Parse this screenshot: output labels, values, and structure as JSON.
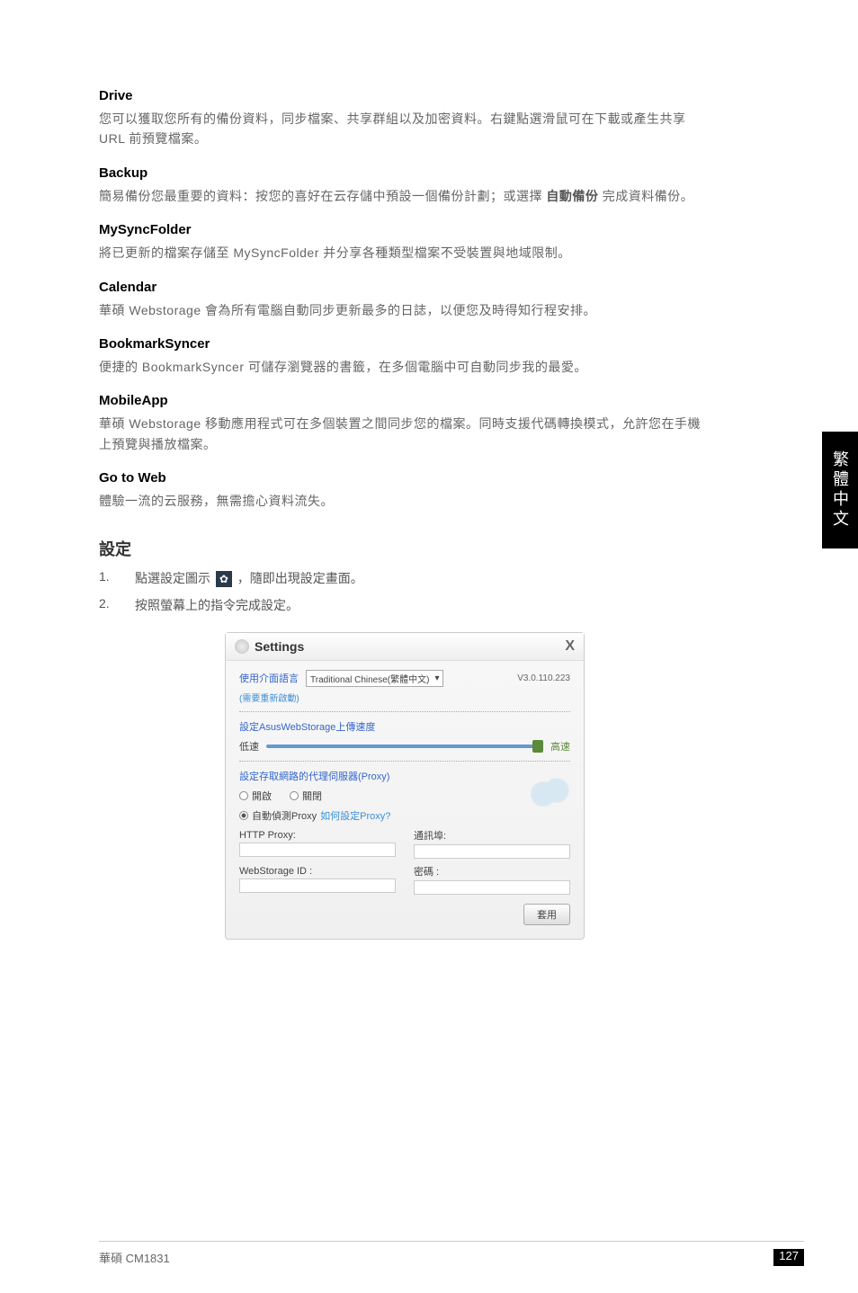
{
  "sections": {
    "drive": {
      "title": "Drive",
      "text": "您可以獲取您所有的備份資料，同步檔案、共享群組以及加密資料。右鍵點選滑鼠可在下載或產生共享 URL 前預覽檔案。"
    },
    "backup": {
      "title": "Backup",
      "text_part1": "簡易備份您最重要的資料：按您的喜好在云存儲中預設一個備份計劃；或選擇 ",
      "text_bold": "自動備份",
      "text_part2": " 完成資料備份。"
    },
    "mysyncfolder": {
      "title": "MySyncFolder",
      "text": "將已更新的檔案存儲至 MySyncFolder 并分享各種類型檔案不受裝置與地域限制。"
    },
    "calendar": {
      "title": "Calendar",
      "text": "華碩 Webstorage 會為所有電腦自動同步更新最多的日誌，以便您及時得知行程安排。"
    },
    "bookmarksyncer": {
      "title": "BookmarkSyncer",
      "text": "便捷的 BookmarkSyncer 可儲存瀏覽器的書籤，在多個電腦中可自動同步我的最愛。"
    },
    "mobileapp": {
      "title": "MobileApp",
      "text": "華碩 Webstorage 移動應用程式可在多個裝置之間同步您的檔案。同時支援代碼轉換模式，允許您在手機上預覽與播放檔案。"
    },
    "gotoweb": {
      "title": "Go to Web",
      "text": "體驗一流的云服務，無需擔心資料流失。"
    }
  },
  "settings_section": {
    "title": "設定",
    "step1_part1": "點選設定圖示 ",
    "step1_part2": " ，隨即出現設定畫面。",
    "step2": "按照螢幕上的指令完成設定。"
  },
  "dialog": {
    "title": "Settings",
    "close": "X",
    "lang_label": "使用介面語言",
    "lang_value": "Traditional Chinese(繁體中文)",
    "version": "V3.0.110.223",
    "restart_note": "(需要重新啟動)",
    "upload_speed_label": "設定AsusWebStorage上傳速度",
    "slider_low": "低速",
    "slider_high": "高速",
    "proxy_label": "設定存取網路的代理伺服器(Proxy)",
    "radio_open": "開啟",
    "radio_close": "關閉",
    "radio_auto_part1": "自動偵測Proxy ",
    "radio_auto_link": "如何設定Proxy?",
    "http_proxy_label": "HTTP Proxy:",
    "port_label": "通訊埠:",
    "webstorage_id_label": "WebStorage ID :",
    "password_label": "密碼 :",
    "apply_button": "套用"
  },
  "side_tab": "繁體中文",
  "footer": {
    "left": "華碩 CM1831",
    "right": "127"
  },
  "gear_glyph": "✿"
}
